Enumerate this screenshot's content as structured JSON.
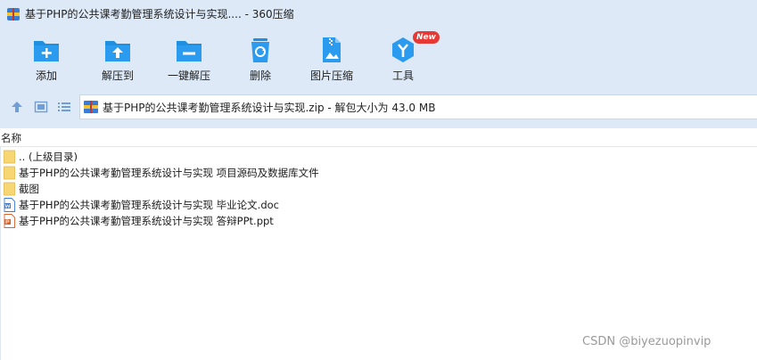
{
  "window": {
    "title": "基于PHP的公共课考勤管理系统设计与实现.... - 360压缩"
  },
  "toolbar": {
    "items": [
      {
        "label": "添加",
        "icon": "add-icon"
      },
      {
        "label": "解压到",
        "icon": "extract-to-icon"
      },
      {
        "label": "一键解压",
        "icon": "one-click-extract-icon"
      },
      {
        "label": "删除",
        "icon": "delete-icon"
      },
      {
        "label": "图片压缩",
        "icon": "image-compress-icon"
      },
      {
        "label": "工具",
        "icon": "tools-icon",
        "badge": "New"
      }
    ]
  },
  "nav": {
    "path": "基于PHP的公共课考勤管理系统设计与实现.zip - 解包大小为 43.0 MB"
  },
  "columns": {
    "name": "名称"
  },
  "files": [
    {
      "name": ".. (上级目录)",
      "type": "folder"
    },
    {
      "name": "基于PHP的公共课考勤管理系统设计与实现 项目源码及数据库文件",
      "type": "folder"
    },
    {
      "name": "截图",
      "type": "folder"
    },
    {
      "name": "基于PHP的公共课考勤管理系统设计与实现 毕业论文.doc",
      "type": "doc"
    },
    {
      "name": "基于PHP的公共课考勤管理系统设计与实现 答辩PPt.ppt",
      "type": "ppt"
    }
  ],
  "watermark": "CSDN @biyezuopinvip",
  "colors": {
    "chrome": "#dde9f7",
    "icon_blue": "#1f8fe0",
    "folder": "#f7d774",
    "badge": "#e53935"
  }
}
